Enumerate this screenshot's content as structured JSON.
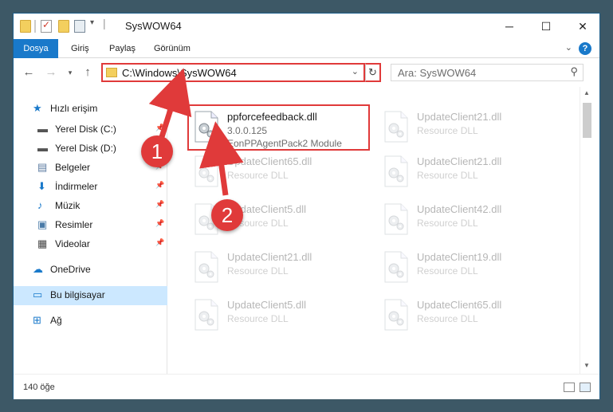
{
  "window": {
    "title": "SysWOW64",
    "minimize": "─",
    "maximize": "☐",
    "close": "✕"
  },
  "ribbon": {
    "tabs": [
      "Dosya",
      "Giriş",
      "Paylaş",
      "Görünüm"
    ],
    "help": "?"
  },
  "address": {
    "path": "C:\\Windows\\SysWOW64",
    "search_placeholder": "Ara: SysWOW64"
  },
  "sidebar": {
    "items": [
      {
        "label": "Hızlı erişim",
        "icon": "star-icon",
        "pinned": false
      },
      {
        "label": "Yerel Disk (C:)",
        "icon": "drive-icon",
        "pinned": true
      },
      {
        "label": "Yerel Disk (D:)",
        "icon": "drive-icon",
        "pinned": true
      },
      {
        "label": "Belgeler",
        "icon": "documents-icon",
        "pinned": true
      },
      {
        "label": "İndirmeler",
        "icon": "downloads-icon",
        "pinned": true
      },
      {
        "label": "Müzik",
        "icon": "music-icon",
        "pinned": true
      },
      {
        "label": "Resimler",
        "icon": "pictures-icon",
        "pinned": true
      },
      {
        "label": "Videolar",
        "icon": "videos-icon",
        "pinned": true
      },
      {
        "label": "OneDrive",
        "icon": "cloud-icon",
        "pinned": false
      },
      {
        "label": "Bu bilgisayar",
        "icon": "computer-icon",
        "pinned": false,
        "selected": true
      },
      {
        "label": "Ağ",
        "icon": "network-icon",
        "pinned": false
      }
    ]
  },
  "files": {
    "left": [
      {
        "name": "ppforcefeedback.dll",
        "version": "3.0.0.125",
        "desc": "EonPPAgentPack2 Module",
        "highlight": true
      },
      {
        "name": "UpdateClient65.dll",
        "desc": "Resource DLL"
      },
      {
        "name": "UpdateClient5.dll",
        "desc": "Resource DLL"
      },
      {
        "name": "UpdateClient21.dll",
        "desc": "Resource DLL"
      },
      {
        "name": "UpdateClient5.dll",
        "desc": "Resource DLL"
      }
    ],
    "right": [
      {
        "name": "UpdateClient21.dll",
        "desc": "Resource DLL"
      },
      {
        "name": "UpdateClient21.dll",
        "desc": "Resource DLL"
      },
      {
        "name": "UpdateClient42.dll",
        "desc": "Resource DLL"
      },
      {
        "name": "UpdateClient19.dll",
        "desc": "Resource DLL"
      },
      {
        "name": "UpdateClient65.dll",
        "desc": "Resource DLL"
      }
    ]
  },
  "status": {
    "count": "140 öğe"
  },
  "annotations": {
    "step1": "1",
    "step2": "2",
    "color": "#e03a3a"
  }
}
